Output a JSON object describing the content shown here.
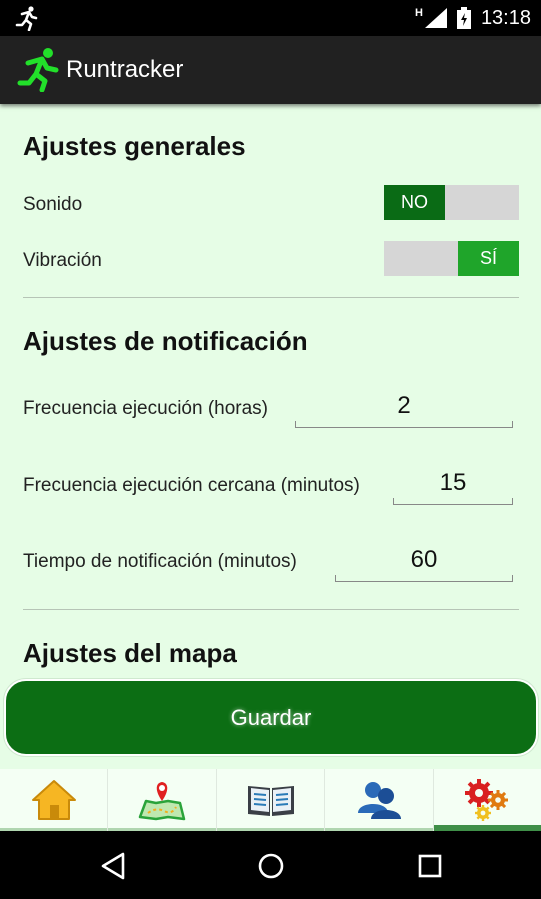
{
  "status_bar": {
    "network": "H",
    "time": "13:18",
    "icons": [
      "runner-notification-icon",
      "signal-icon",
      "battery-icon"
    ]
  },
  "app_bar": {
    "title": "Runtracker",
    "logo_icon": "runner-logo-icon"
  },
  "general": {
    "title": "Ajustes generales",
    "sound_label": "Sonido",
    "sound_toggle": "NO",
    "vibration_label": "Vibración",
    "vibration_toggle": "SÍ"
  },
  "notification": {
    "title": "Ajustes de notificación",
    "freq_label": "Frecuencia ejecución (horas)",
    "freq_value": "2",
    "near_label": "Frecuencia ejecución cercana (minutos)",
    "near_value": "15",
    "time_label": "Tiempo de notificación (minutos)",
    "time_value": "60"
  },
  "map": {
    "title": "Ajustes del mapa"
  },
  "save_button": "Guardar",
  "tabs": [
    {
      "icon": "home-icon"
    },
    {
      "icon": "map-icon"
    },
    {
      "icon": "book-icon"
    },
    {
      "icon": "users-icon"
    },
    {
      "icon": "settings-gears-icon",
      "active": true
    }
  ],
  "nav": [
    "back-icon",
    "home-circle-icon",
    "recents-icon"
  ],
  "colors": {
    "primary": "#0a6b15",
    "accent_on": "#1fa52a",
    "background": "#e6fde6",
    "app_bar": "#212121"
  }
}
